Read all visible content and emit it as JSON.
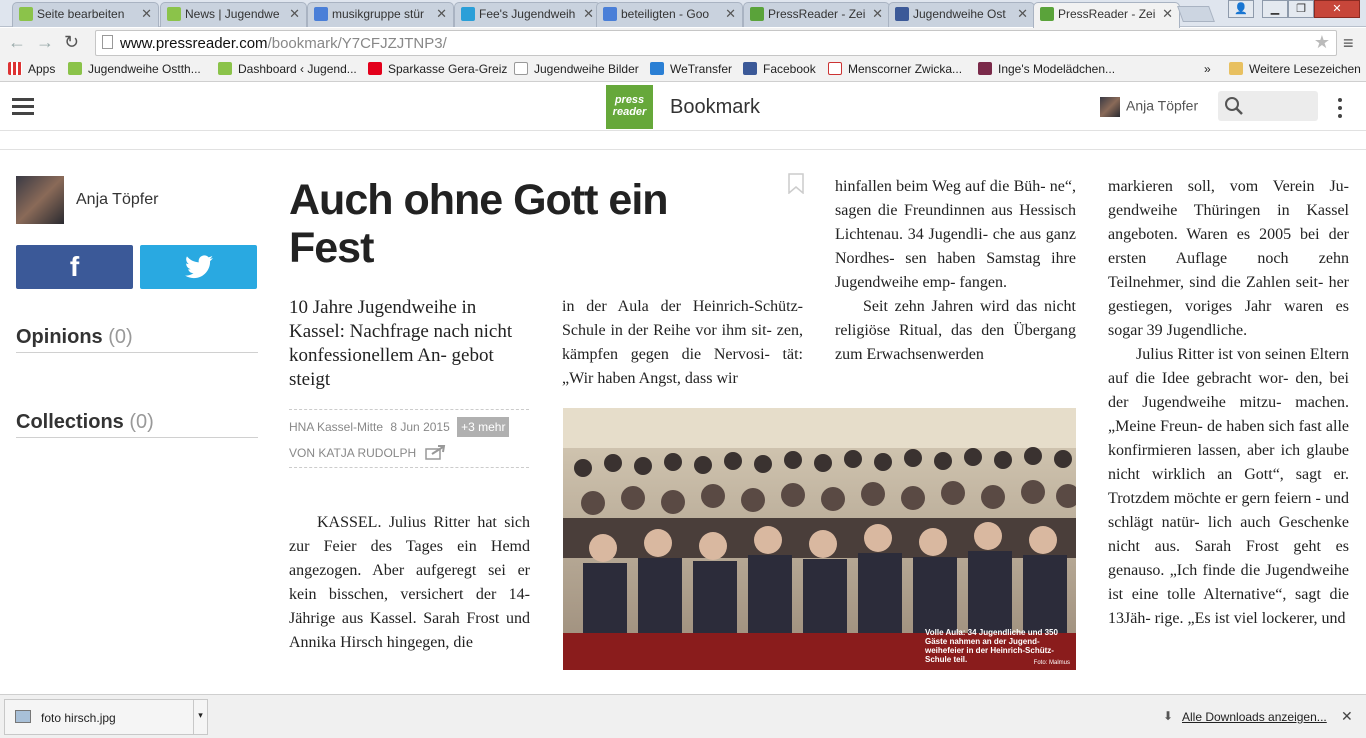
{
  "browser": {
    "tabs": [
      {
        "title": "Seite bearbeiten",
        "icon_color": "#8bc34a"
      },
      {
        "title": "News | Jugendwe",
        "icon_color": "#8bc34a"
      },
      {
        "title": "musikgruppe stür",
        "icon_color": "#4a7fd8"
      },
      {
        "title": "Fee's Jugendweih",
        "icon_color": "#2a9fd8"
      },
      {
        "title": "beteiligten - Goo",
        "icon_color": "#4a7fd8"
      },
      {
        "title": "PressReader - Zei",
        "icon_color": "#5aa33a"
      },
      {
        "title": "Jugendweihe Ost",
        "icon_color": "#3b5998"
      },
      {
        "title": "PressReader - Zei",
        "icon_color": "#5aa33a"
      }
    ],
    "url_host": "www.pressreader.com",
    "url_path": "/bookmark/Y7CFJZJTNP3/",
    "bookmarks": [
      {
        "label": "Apps",
        "icon": "apps-grid-icon"
      },
      {
        "label": "Jugendweihe Ostth...",
        "icon": "leaf-icon"
      },
      {
        "label": "Dashboard ‹ Jugend...",
        "icon": "leaf-icon"
      },
      {
        "label": "Sparkasse Gera-Greiz",
        "icon": "sparkasse-icon"
      },
      {
        "label": "Jugendweihe Bilder",
        "icon": "page-icon"
      },
      {
        "label": "WeTransfer",
        "icon": "wetransfer-icon"
      },
      {
        "label": "Facebook",
        "icon": "facebook-icon"
      },
      {
        "label": "Menscorner Zwicka...",
        "icon": "mc-icon"
      },
      {
        "label": "Inge's Modelädchen...",
        "icon": "inge-icon"
      }
    ],
    "bookmarks_more": "»",
    "other_bookmarks": "Weitere Lesezeichen"
  },
  "appbar": {
    "logo_line1": "press",
    "logo_line2": "reader",
    "title": "Bookmark",
    "user": "Anja Töpfer"
  },
  "sidebar": {
    "user": "Anja Töpfer",
    "facebook_label": "f",
    "opinions_label": "Opinions",
    "opinions_count": "(0)",
    "collections_label": "Collections",
    "collections_count": "(0)"
  },
  "article": {
    "headline": "Auch ohne Gott ein Fest",
    "subhead": "10 Jahre Jugendweihe in Kassel: Nachfrage nach nicht konfessionellem An- gebot steigt",
    "source": "HNA Kassel-Mitte",
    "date": "8 Jun 2015",
    "more": "+3 mehr",
    "byline": "VON KATJA RUDOLPH",
    "col1": "KASSEL. Julius Ritter hat sich zur Feier des Tages ein Hemd angezogen. Aber aufgeregt sei er kein bisschen, versichert der 14-Jährige aus Kassel. Sarah Frost und Annika Hirsch hingegen, die",
    "col2": "in der Aula der Heinrich-Schütz-Schule in der Reihe vor ihm sit- zen, kämpfen gegen die Nervosi- tät: „Wir haben Angst, dass wir",
    "col3a": "hinfallen beim Weg auf die Büh- ne“, sagen die Freundinnen aus Hessisch Lichtenau. 34 Jugendli- che aus ganz Nordhes- sen haben Samstag ihre Jugendweihe emp- fangen.",
    "col3b": "Seit zehn Jahren wird das nicht religiöse Ritual, das den Übergang zum Erwachsenwerden",
    "col4a": "markieren soll, vom Verein Ju- gendweihe Thüringen in Kassel angeboten. Waren es 2005 bei der ersten Auflage noch zehn Teilnehmer, sind die Zahlen seit- her gestiegen, voriges Jahr waren es sogar 39 Jugendliche.",
    "col4b": "Julius Ritter ist von seinen Eltern auf die Idee gebracht wor- den, bei der Jugendweihe mitzu- machen. „Meine Freun- de haben sich fast alle konfirmieren lassen, aber ich glaube nicht wirklich an Gott“, sagt er. Trotzdem möchte er gern feiern - und schlägt natür- lich auch Geschenke nicht aus. Sarah Frost geht es genauso. „Ich finde die Jugendweihe ist eine tolle Alternative“, sagt die 13Jäh- rige. „Es ist viel lockerer, und",
    "photo_caption": "Volle Aula: 34 Jugendliche und 350 Gäste nahmen an der Jugend- weihefeier in der Heinrich-Schütz- Schule teil.",
    "photo_credit": "Foto: Malmus"
  },
  "downloads": {
    "file": "foto hirsch.jpg",
    "show_all": "Alle Downloads anzeigen..."
  }
}
